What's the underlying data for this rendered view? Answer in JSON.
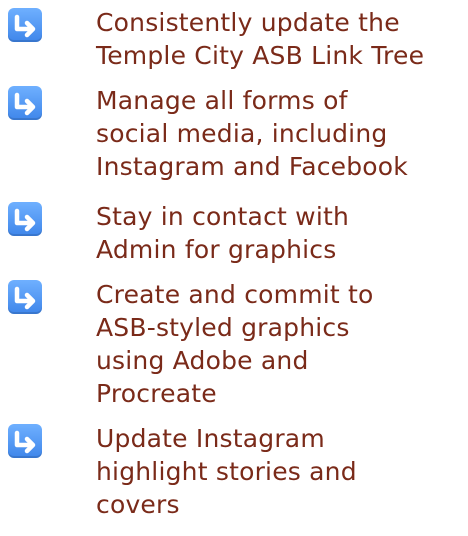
{
  "colors": {
    "text": "#7a2a19",
    "icon_bg": "#4a90f0",
    "icon_fg": "#ffffff"
  },
  "bullet_icon": "right-turn-arrow-icon",
  "items": [
    {
      "text": "Consistently update the\nTemple City ASB Link Tree"
    },
    {
      "text": "Manage all forms of\nsocial media, including\nInstagram and Facebook"
    },
    {
      "text": "Stay in contact with\nAdmin for graphics"
    },
    {
      "text": "Create and commit to\nASB-styled graphics\nusing Adobe and\nProcreate"
    },
    {
      "text": "Update Instagram\nhighlight stories and\ncovers"
    }
  ]
}
